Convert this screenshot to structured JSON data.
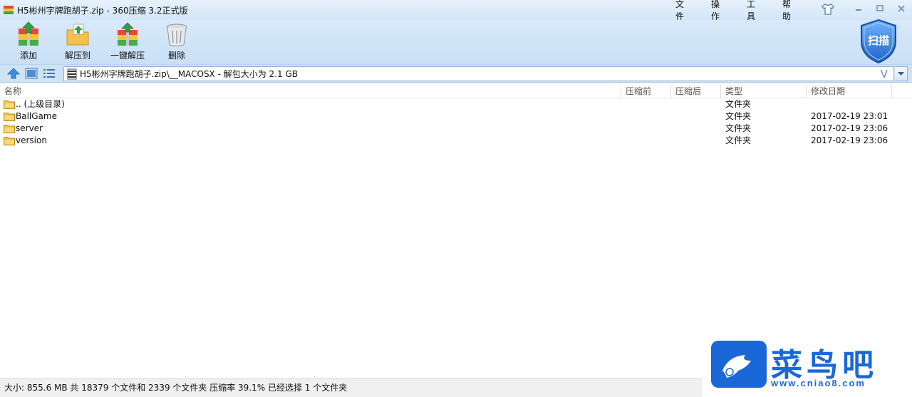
{
  "window": {
    "title": "H5彬州字牌跑胡子.zip - 360压缩 3.2正式版"
  },
  "menu": [
    "文件",
    "操作",
    "工具",
    "帮助"
  ],
  "toolbar": {
    "add_label": "添加",
    "extract_to_label": "解压到",
    "one_click_extract_label": "一键解压",
    "delete_label": "删除",
    "scan_label": "扫描"
  },
  "address": {
    "path": "H5彬州字牌跑胡子.zip\\__MACOSX - 解包大小为 2.1 GB",
    "v_mark": "V"
  },
  "columns": {
    "name": "名称",
    "before": "压缩前",
    "after": "压缩后",
    "type": "类型",
    "modified": "修改日期"
  },
  "rows": [
    {
      "name": ".. (上级目录)",
      "type": "文件夹",
      "date": ""
    },
    {
      "name": "BallGame",
      "type": "文件夹",
      "date": "2017-02-19 23:01"
    },
    {
      "name": "server",
      "type": "文件夹",
      "date": "2017-02-19 23:06"
    },
    {
      "name": "version",
      "type": "文件夹",
      "date": "2017-02-19 23:06"
    }
  ],
  "status": "大小: 855.6 MB 共 18379 个文件和 2339 个文件夹 压缩率 39.1% 已经选择 1 个文件夹",
  "watermark": {
    "brand": "菜鸟吧",
    "url": "www.cniao8.com"
  },
  "colors": {
    "accent": "#1a68d8",
    "folder": "#f2c14e"
  }
}
